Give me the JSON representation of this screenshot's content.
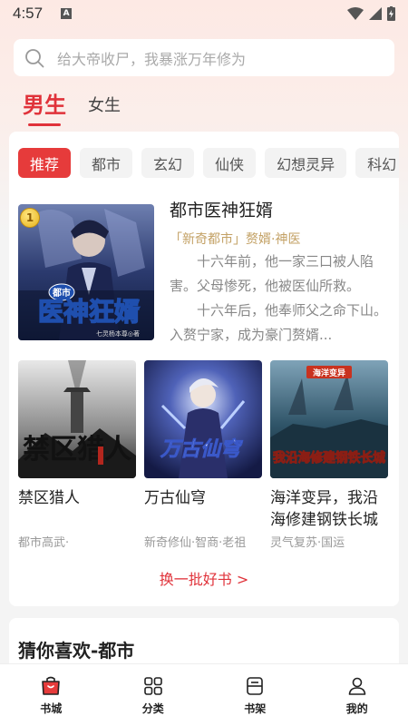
{
  "status": {
    "time": "4:57",
    "badge": "A"
  },
  "search": {
    "placeholder": "给大帝收尸，我暴涨万年修为"
  },
  "gender_tabs": {
    "male": "男生",
    "female": "女生"
  },
  "categories": [
    "推荐",
    "都市",
    "玄幻",
    "仙侠",
    "幻想灵异",
    "科幻"
  ],
  "featured": {
    "rank": "1",
    "title": "都市医神狂婿",
    "tags": "「新奇都市」赘婿·神医",
    "desc_1": "十六年前，他一家三口被人陷害。父母惨死，他被医仙所救。",
    "desc_2": "十六年后，他奉师父之命下山。入赘宁家，成为豪门赘婿...",
    "cover_text": "医神狂婿",
    "cover_small": "都市",
    "cover_author": "七灵杨本尊◎著"
  },
  "books": [
    {
      "title": "禁区猎人",
      "tags": "都市高武·",
      "cover_text": "禁区猎人"
    },
    {
      "title": "万古仙穹",
      "tags": "新奇修仙·智商·老祖",
      "cover_text": "万古仙穹"
    },
    {
      "title": "海洋变异，我沿海修建钢铁长城",
      "tags": "灵气复苏·国运",
      "cover_text": "我沿海修建钢铁长城",
      "cover_small": "海洋变异"
    }
  ],
  "more_label": "换一批好书 >",
  "guess": {
    "title": "猜你喜欢-都市"
  },
  "tabbar": {
    "home": "书城",
    "category": "分类",
    "shelf": "书架",
    "mine": "我的"
  },
  "colors": {
    "accent": "#e0323a",
    "tag": "#c3a165"
  }
}
